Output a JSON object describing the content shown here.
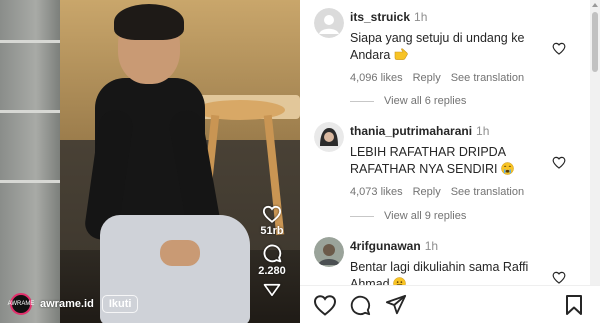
{
  "video": {
    "username": "awrame.id",
    "avatar_text": "AWRAME",
    "follow_label": "Ikuti",
    "likes_count": "51rb",
    "comments_count": "2.280",
    "icons": [
      "heart-icon",
      "comment-icon",
      "share-icon"
    ]
  },
  "comments": [
    {
      "username": "its_struick",
      "time": "1h",
      "text": "Siapa yang setuju di undang ke Andara",
      "emoji": "backhand-index-pointing-right",
      "likes": "4,096 likes",
      "reply_label": "Reply",
      "translate_label": "See translation",
      "view_replies": "View all 6 replies"
    },
    {
      "username": "thania_putrimaharani",
      "time": "1h",
      "text": "LEBIH RAFATHAR DRIPDA RAFATHAR NYA SENDIRI",
      "emoji": "crying-face",
      "likes": "4,073 likes",
      "reply_label": "Reply",
      "translate_label": "See translation",
      "view_replies": "View all 9 replies"
    },
    {
      "username": "4rifgunawan",
      "time": "1h",
      "text": "Bentar lagi dikuliahin sama Raffi Ahmad",
      "emoji": "grinning-face"
    }
  ],
  "action_bar": {
    "icons": [
      "heart-icon",
      "comment-icon",
      "share-icon",
      "bookmark-icon"
    ]
  },
  "colors": {
    "text": "#262626",
    "secondary_text": "#737373",
    "divider": "#efefef",
    "emoji_yellow": "#f7c325"
  }
}
